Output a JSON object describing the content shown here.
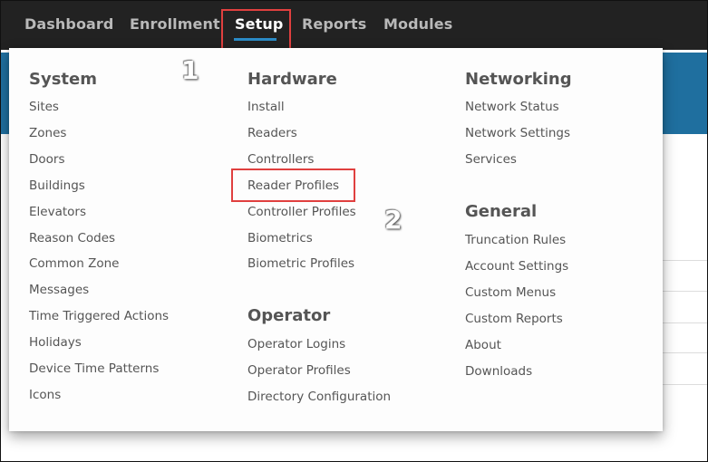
{
  "nav": {
    "items": [
      {
        "label": "Dashboard"
      },
      {
        "label": "Enrollment"
      },
      {
        "label": "Setup"
      },
      {
        "label": "Reports"
      },
      {
        "label": "Modules"
      }
    ],
    "active": "Setup"
  },
  "menu": {
    "system": {
      "title": "System",
      "items": [
        "Sites",
        "Zones",
        "Doors",
        "Buildings",
        "Elevators",
        "Reason Codes",
        "Common Zone",
        "Messages",
        "Time Triggered Actions",
        "Holidays",
        "Device Time Patterns",
        "Icons"
      ]
    },
    "hardware": {
      "title": "Hardware",
      "items": [
        "Install",
        "Readers",
        "Controllers",
        "Reader Profiles",
        "Controller Profiles",
        "Biometrics",
        "Biometric Profiles"
      ]
    },
    "operator": {
      "title": "Operator",
      "items": [
        "Operator Logins",
        "Operator Profiles",
        "Directory Configuration"
      ]
    },
    "networking": {
      "title": "Networking",
      "items": [
        "Network Status",
        "Network Settings",
        "Services"
      ]
    },
    "general": {
      "title": "General",
      "items": [
        "Truncation Rules",
        "Account Settings",
        "Custom Menus",
        "Custom Reports",
        "About",
        "Downloads"
      ]
    }
  },
  "annotations": [
    "1",
    "2"
  ],
  "colors": {
    "nav_bg": "#222222",
    "accent": "#2b8bc6",
    "annotation": "#e0403f",
    "band": "#1f6f9f"
  }
}
